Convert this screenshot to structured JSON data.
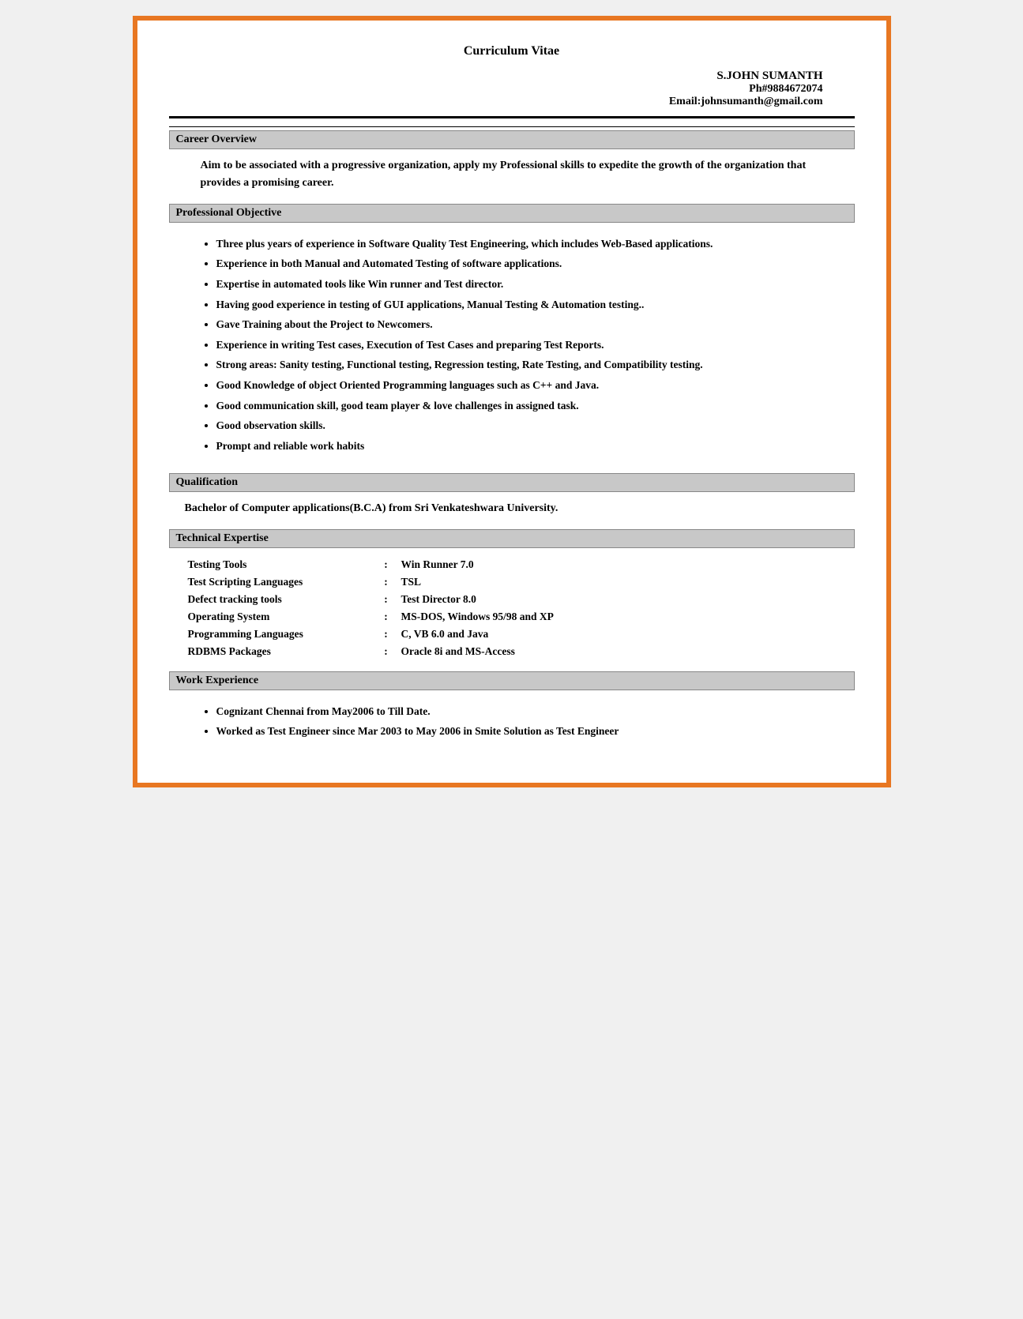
{
  "header": {
    "cv_title": "Curriculum Vitae",
    "name": "S.JOHN SUMANTH",
    "phone_label": "Ph#",
    "phone": "9884672074",
    "email_label": "Email:",
    "email": "johnsumanth@gmail.com"
  },
  "sections": {
    "career_overview": {
      "heading": "Career Overview",
      "text": "Aim to be associated with a progressive organization, apply my Professional skills to expedite the growth of the organization that provides a promising career."
    },
    "professional_objective": {
      "heading": "Professional Objective",
      "items": [
        "Three plus years of experience in Software Quality Test Engineering, which includes Web-Based applications.",
        "Experience in both Manual and Automated Testing of software applications.",
        "Expertise in automated tools like Win runner and Test director.",
        "Having good experience in testing of GUI applications, Manual Testing & Automation testing..",
        "Gave Training about the Project to Newcomers.",
        "Experience in writing Test cases, Execution of Test Cases and preparing Test Reports.",
        "Strong areas: Sanity testing, Functional testing, Regression testing, Rate Testing, and Compatibility testing.",
        "Good Knowledge of object Oriented Programming languages such as C++ and Java.",
        "Good communication skill, good team player & love challenges in assigned task.",
        "Good observation skills.",
        "Prompt and reliable work habits"
      ]
    },
    "qualification": {
      "heading": "Qualification",
      "text": "Bachelor of Computer applications(B.C.A)  from Sri Venkateshwara University."
    },
    "technical_expertise": {
      "heading": "Technical Expertise",
      "rows": [
        {
          "label": "Testing Tools",
          "separator": ":",
          "value": "Win Runner 7.0"
        },
        {
          "label": "Test Scripting Languages",
          "separator": ":",
          "value": "TSL"
        },
        {
          "label": "Defect tracking tools",
          "separator": ":",
          "value": "Test Director 8.0"
        },
        {
          "label": "Operating System",
          "separator": ":",
          "value": "MS-DOS, Windows 95/98 and XP"
        },
        {
          "label": "Programming Languages",
          "separator": ":",
          "value": "C, VB 6.0 and Java"
        },
        {
          "label": "RDBMS Packages",
          "separator": ":",
          "value": "Oracle 8i and MS-Access"
        }
      ]
    },
    "work_experience": {
      "heading": "Work Experience",
      "items": [
        "Cognizant Chennai from May2006 to Till Date.",
        "Worked as Test Engineer since Mar 2003 to May 2006 in Smite Solution as Test Engineer"
      ]
    }
  }
}
